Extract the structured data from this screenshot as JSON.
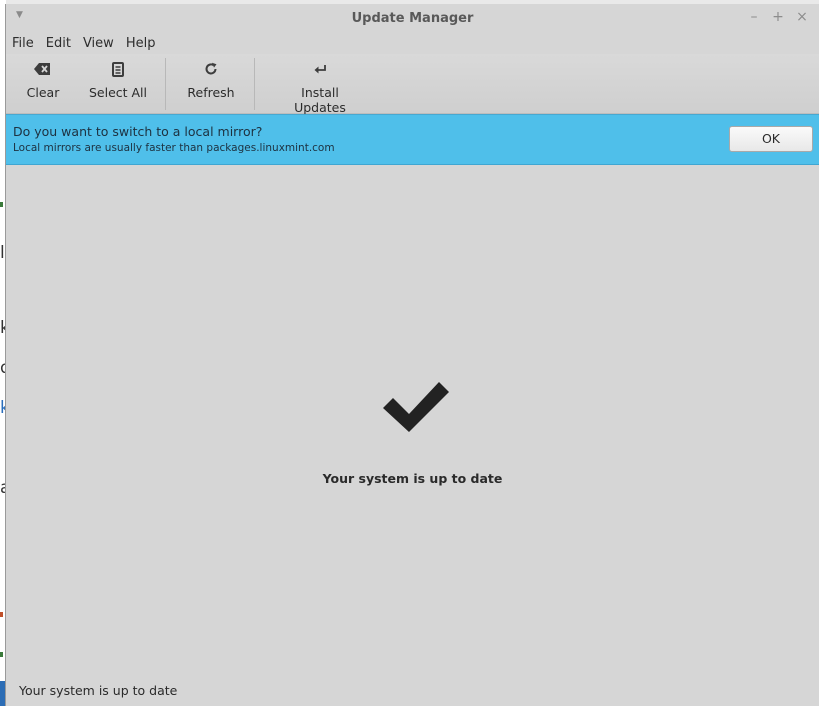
{
  "window": {
    "title": "Update Manager",
    "minimize": "–",
    "maximize": "+",
    "close": "×"
  },
  "menu": [
    "File",
    "Edit",
    "View",
    "Help"
  ],
  "toolbar": {
    "clear_label": "Clear",
    "select_all_label": "Select All",
    "refresh_label": "Refresh",
    "install_label": "Install Updates"
  },
  "infobar": {
    "question": "Do you want to switch to a local mirror?",
    "detail": "Local mirrors are usually faster than packages.linuxmint.com",
    "ok_label": "OK",
    "color": "#4fbfea"
  },
  "main": {
    "status_message": "Your system is up to date"
  },
  "statusbar": {
    "text": "Your system is up to date"
  }
}
